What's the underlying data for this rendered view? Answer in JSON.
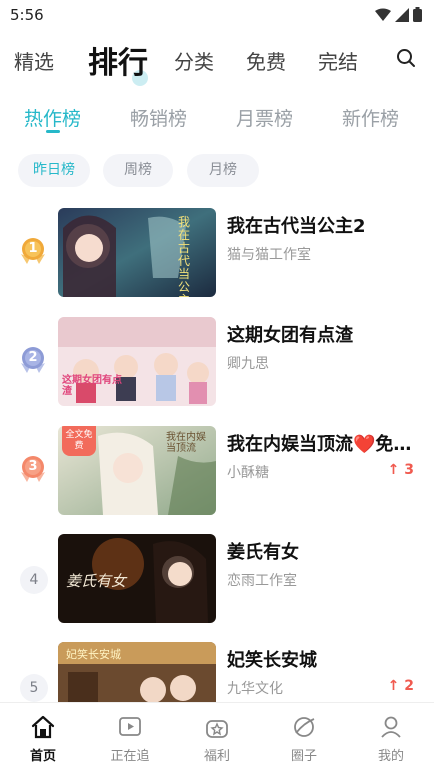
{
  "status_bar": {
    "time": "5:56"
  },
  "top_tabs": [
    {
      "label": "精选"
    },
    {
      "label": "排行",
      "active": true
    },
    {
      "label": "分类"
    },
    {
      "label": "免费"
    },
    {
      "label": "完结"
    }
  ],
  "sub_tabs": [
    {
      "label": "热作榜",
      "active": true
    },
    {
      "label": "畅销榜"
    },
    {
      "label": "月票榜"
    },
    {
      "label": "新作榜"
    }
  ],
  "chips": [
    {
      "label": "昨日榜",
      "active": true
    },
    {
      "label": "周榜"
    },
    {
      "label": "月榜"
    }
  ],
  "items": [
    {
      "rank": "1",
      "title": "我在古代当公主2",
      "author": "猫与猫工作室",
      "trend": "",
      "badge": "",
      "cover_text": "我在古代当公主"
    },
    {
      "rank": "2",
      "title": "这期女团有点渣",
      "author": "卿九思",
      "trend": "",
      "badge": "",
      "cover_text": "这期女团有点渣"
    },
    {
      "rank": "3",
      "title": "我在内娱当顶流❤️免费看",
      "author": "小酥糖",
      "trend": "↑ 3",
      "badge": "全文免费",
      "cover_text": "我在内娱当顶流"
    },
    {
      "rank": "4",
      "title": "姜氏有女",
      "author": "恋雨工作室",
      "trend": "",
      "badge": "",
      "cover_text": "姜氏有女"
    },
    {
      "rank": "5",
      "title": "妃笑长安城",
      "author": "九华文化",
      "trend": "↑ 2",
      "badge": "",
      "cover_text": "妃笑长安城"
    }
  ],
  "bottom_nav": [
    {
      "label": "首页",
      "icon": "home-icon",
      "active": true
    },
    {
      "label": "正在追",
      "icon": "play-icon"
    },
    {
      "label": "福利",
      "icon": "gift-icon"
    },
    {
      "label": "圈子",
      "icon": "circle-icon"
    },
    {
      "label": "我的",
      "icon": "user-icon"
    }
  ],
  "colors": {
    "accent": "#26b8c9",
    "gold": "#f0a93a",
    "silver": "#8d9bd6",
    "bronze": "#f4886a",
    "trend_up": "#f05a4f"
  }
}
